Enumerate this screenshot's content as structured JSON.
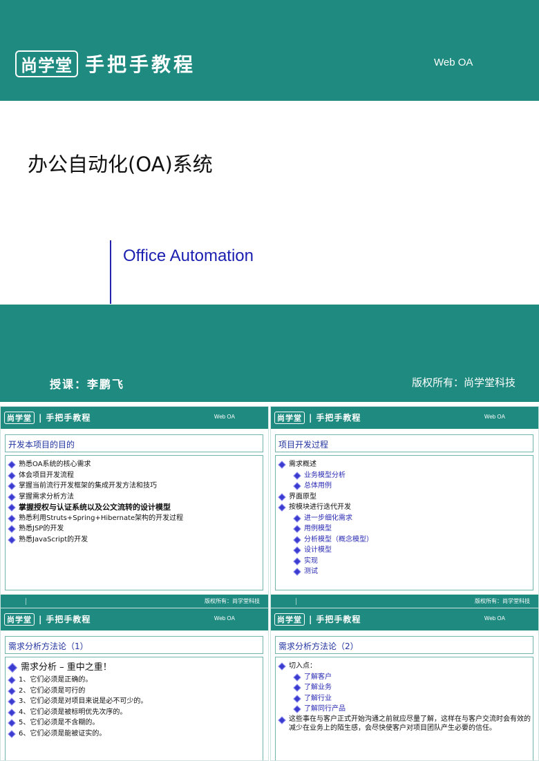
{
  "cover": {
    "logo_brand": "尚学堂",
    "logo_text": "手把手教程",
    "tag": "Web OA",
    "title": "办公自动化(OA)系统",
    "subtitle": "Office Automation",
    "teacher": "授课：李鹏飞",
    "copyright": "版权所有：尚学堂科技"
  },
  "slide_common": {
    "logo_brand": "尚学堂",
    "logo_sep": "|",
    "logo_text": "手把手教程",
    "tag": "Web OA",
    "copyright": "版权所有：尚学堂科技"
  },
  "slides": [
    {
      "title": "开发本项目的目的",
      "items": [
        "熟悉OA系统的核心需求",
        "体会项目开发流程",
        "掌握当前流行开发框架的集成开发方法和技巧",
        "掌握需求分析方法",
        "掌握授权与认证系统以及公文流转的设计模型",
        "熟悉利用Struts+Spring+Hibernate架构的开发过程",
        "熟悉JSP的开发",
        "熟悉JavaScript的开发"
      ]
    },
    {
      "title": "项目开发过程",
      "items": [
        "需求概述",
        "业务模型分析",
        "总体用例",
        "界面原型",
        "按模块进行迭代开发",
        "进一步细化需求",
        "用例模型",
        "分析模型（概念模型）",
        "设计模型",
        "实现",
        "测试"
      ]
    },
    {
      "title": "需求分析方法论（1）",
      "items": [
        "需求分析 – 重中之重！",
        "1、它们必须是正确的。",
        "2、它们必须是可行的",
        "3、它们必须是对项目来说是必不可少的。",
        "4、它们必须是被标明优先次序的。",
        "5、它们必须是不含糊的。",
        "6、它们必须是能被证实的。"
      ]
    },
    {
      "title": "需求分析方法论（2）",
      "items": [
        "切入点：",
        "了解客户",
        "了解业务",
        "了解行业",
        "了解同行产品",
        "这些事在与客户正式开始沟通之前就应尽量了解，这样在与客户交流时会有效的减少在业务上的陌生感，会尽快使客户对项目团队产生必要的信任。"
      ]
    }
  ],
  "colors": {
    "teal": "#1f8a80",
    "title_blue": "#2033a0",
    "subtitle_blue": "#1b1fb0",
    "bullet": "#3b3bd0"
  }
}
